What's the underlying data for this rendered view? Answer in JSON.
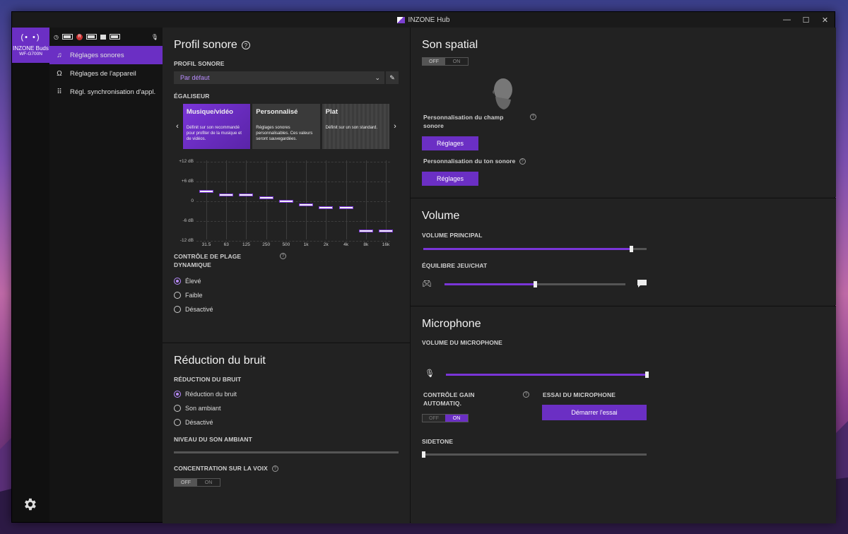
{
  "window": {
    "title": "INZONE Hub",
    "minimize": "—",
    "maximize": "☐",
    "close": "✕"
  },
  "sidebar": {
    "device_name": "INZONE Buds",
    "device_model": "WF-G700N",
    "buds_glyph": "(• •)"
  },
  "status": {
    "clock_glyph": "◷",
    "r_glyph": "R"
  },
  "nav": {
    "items": [
      {
        "label": "Réglages sonores",
        "icon": "music-note-icon",
        "glyph": "♫",
        "active": true
      },
      {
        "label": "Réglages de l'appareil",
        "icon": "headphones-icon",
        "glyph": "Ω",
        "active": false
      },
      {
        "label": "Régl. synchronisation d'appl.",
        "icon": "grid-icon",
        "glyph": "⠿",
        "active": false
      }
    ]
  },
  "profile": {
    "title": "Profil sonore",
    "section_label": "PROFIL SONORE",
    "selected": "Par défaut",
    "eq_label": "ÉGALISEUR",
    "presets": [
      {
        "title": "Musique/vidéo",
        "desc": "Définit sur son recommandé pour profiter de la musique et de vidéos."
      },
      {
        "title": "Personnalisé",
        "desc": "Réglages sonores personnalisables. Ces valeurs seront sauvegardées."
      },
      {
        "title": "Plat",
        "desc": "Définit sur un son standard."
      }
    ],
    "eq": {
      "y_labels": [
        "+12 dB",
        "+6 dB",
        "0",
        "-6 dB",
        "-12 dB"
      ],
      "bands": [
        "31.5",
        "63",
        "125",
        "250",
        "500",
        "1k",
        "2k",
        "4k",
        "8k",
        "16k"
      ],
      "values_db": [
        3,
        2,
        2,
        1,
        0,
        -1,
        -2,
        -2,
        -9,
        -9
      ]
    },
    "drc_label": "CONTRÔLE DE PLAGE DYNAMIQUE",
    "drc_options": [
      "Élevé",
      "Faible",
      "Désactivé"
    ]
  },
  "noise": {
    "title": "Réduction du bruit",
    "section_label": "RÉDUCTION DU BRUIT",
    "options": [
      "Réduction du bruit",
      "Son ambiant",
      "Désactivé"
    ],
    "ambient_label": "NIVEAU DU SON AMBIANT",
    "voice_label": "CONCENTRATION SUR LA VOIX",
    "off": "OFF",
    "on": "ON"
  },
  "spatial": {
    "title": "Son spatial",
    "off": "OFF",
    "on": "ON",
    "field_label": "Personnalisation du champ sonore",
    "tone_label": "Personnalisation du ton sonore",
    "settings_btn": "Réglages"
  },
  "volume": {
    "title": "Volume",
    "main_label": "VOLUME PRINCIPAL",
    "main_value": 0.93,
    "balance_label": "ÉQUILIBRE JEU/CHAT",
    "balance_value": 0.5
  },
  "microphone": {
    "title": "Microphone",
    "volume_label": "VOLUME DU MICROPHONE",
    "volume_value": 1.0,
    "agc_label": "CONTRÔLE GAIN AUTOMATIQ.",
    "test_label": "ESSAI DU MICROPHONE",
    "test_btn": "Démarrer l'essai",
    "sidetone_label": "SIDETONE",
    "sidetone_value": 0.0,
    "off": "OFF",
    "on": "ON"
  },
  "colors": {
    "accent": "#6b2fc4",
    "accent_text": "#b98cff"
  }
}
